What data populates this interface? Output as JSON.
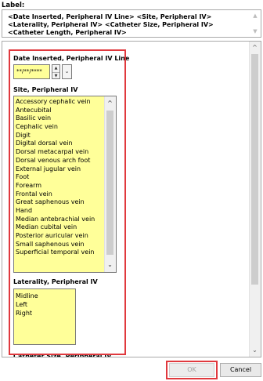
{
  "label_section": {
    "caption": "Label:",
    "text": "<Date Inserted, Peripheral IV Line> <Site, Peripheral IV> <Laterality, Peripheral IV> <Catheter Size, Peripheral IV> <Catheter Length, Peripheral IV>"
  },
  "date_field": {
    "label": "Date Inserted, Peripheral IV Line",
    "value": "**/**/****"
  },
  "site_field": {
    "label": "Site, Peripheral IV",
    "options": [
      "Accessory cephalic vein",
      "Antecubital",
      "Basilic vein",
      "Cephalic vein",
      "Digit",
      "Digital dorsal vein",
      "Dorsal metacarpal vein",
      "Dorsal venous arch foot",
      "External jugular vein",
      "Foot",
      "Forearm",
      "Frontal vein",
      "Great saphenous vein",
      "Hand",
      "Median antebrachial vein",
      "Median cubital vein",
      "Posterior auricular vein",
      "Small saphenous vein",
      "Superficial temporal vein"
    ]
  },
  "laterality_field": {
    "label": "Laterality, Peripheral IV",
    "options": [
      "Midline",
      "Left",
      "Right"
    ]
  },
  "catheter_size_field": {
    "label": "Catheter Size, Peripheral IV"
  },
  "footer": {
    "ok_label": "OK",
    "cancel_label": "Cancel"
  },
  "colors": {
    "field_background": "#ffff99",
    "highlight": "#e0393e"
  },
  "icons": {
    "spin_up": "triangle-up-icon",
    "spin_down": "triangle-down-icon",
    "dropdown": "chevron-down-icon",
    "scroll_up": "chevron-up-icon",
    "scroll_down": "chevron-down-icon"
  }
}
